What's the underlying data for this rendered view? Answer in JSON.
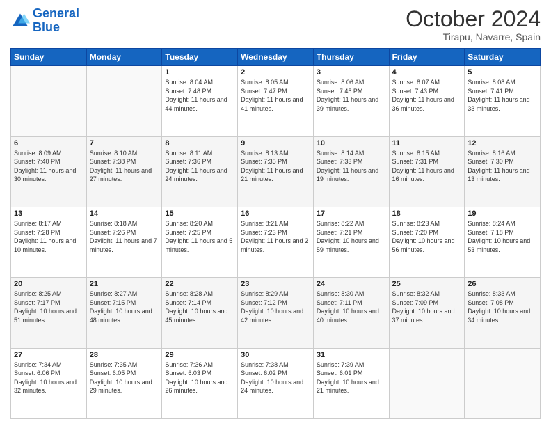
{
  "logo": {
    "text_general": "General",
    "text_blue": "Blue"
  },
  "title": "October 2024",
  "location": "Tirapu, Navarre, Spain",
  "days_of_week": [
    "Sunday",
    "Monday",
    "Tuesday",
    "Wednesday",
    "Thursday",
    "Friday",
    "Saturday"
  ],
  "weeks": [
    [
      {
        "day": "",
        "sunrise": "",
        "sunset": "",
        "daylight": ""
      },
      {
        "day": "",
        "sunrise": "",
        "sunset": "",
        "daylight": ""
      },
      {
        "day": "1",
        "sunrise": "Sunrise: 8:04 AM",
        "sunset": "Sunset: 7:48 PM",
        "daylight": "Daylight: 11 hours and 44 minutes."
      },
      {
        "day": "2",
        "sunrise": "Sunrise: 8:05 AM",
        "sunset": "Sunset: 7:47 PM",
        "daylight": "Daylight: 11 hours and 41 minutes."
      },
      {
        "day": "3",
        "sunrise": "Sunrise: 8:06 AM",
        "sunset": "Sunset: 7:45 PM",
        "daylight": "Daylight: 11 hours and 39 minutes."
      },
      {
        "day": "4",
        "sunrise": "Sunrise: 8:07 AM",
        "sunset": "Sunset: 7:43 PM",
        "daylight": "Daylight: 11 hours and 36 minutes."
      },
      {
        "day": "5",
        "sunrise": "Sunrise: 8:08 AM",
        "sunset": "Sunset: 7:41 PM",
        "daylight": "Daylight: 11 hours and 33 minutes."
      }
    ],
    [
      {
        "day": "6",
        "sunrise": "Sunrise: 8:09 AM",
        "sunset": "Sunset: 7:40 PM",
        "daylight": "Daylight: 11 hours and 30 minutes."
      },
      {
        "day": "7",
        "sunrise": "Sunrise: 8:10 AM",
        "sunset": "Sunset: 7:38 PM",
        "daylight": "Daylight: 11 hours and 27 minutes."
      },
      {
        "day": "8",
        "sunrise": "Sunrise: 8:11 AM",
        "sunset": "Sunset: 7:36 PM",
        "daylight": "Daylight: 11 hours and 24 minutes."
      },
      {
        "day": "9",
        "sunrise": "Sunrise: 8:13 AM",
        "sunset": "Sunset: 7:35 PM",
        "daylight": "Daylight: 11 hours and 21 minutes."
      },
      {
        "day": "10",
        "sunrise": "Sunrise: 8:14 AM",
        "sunset": "Sunset: 7:33 PM",
        "daylight": "Daylight: 11 hours and 19 minutes."
      },
      {
        "day": "11",
        "sunrise": "Sunrise: 8:15 AM",
        "sunset": "Sunset: 7:31 PM",
        "daylight": "Daylight: 11 hours and 16 minutes."
      },
      {
        "day": "12",
        "sunrise": "Sunrise: 8:16 AM",
        "sunset": "Sunset: 7:30 PM",
        "daylight": "Daylight: 11 hours and 13 minutes."
      }
    ],
    [
      {
        "day": "13",
        "sunrise": "Sunrise: 8:17 AM",
        "sunset": "Sunset: 7:28 PM",
        "daylight": "Daylight: 11 hours and 10 minutes."
      },
      {
        "day": "14",
        "sunrise": "Sunrise: 8:18 AM",
        "sunset": "Sunset: 7:26 PM",
        "daylight": "Daylight: 11 hours and 7 minutes."
      },
      {
        "day": "15",
        "sunrise": "Sunrise: 8:20 AM",
        "sunset": "Sunset: 7:25 PM",
        "daylight": "Daylight: 11 hours and 5 minutes."
      },
      {
        "day": "16",
        "sunrise": "Sunrise: 8:21 AM",
        "sunset": "Sunset: 7:23 PM",
        "daylight": "Daylight: 11 hours and 2 minutes."
      },
      {
        "day": "17",
        "sunrise": "Sunrise: 8:22 AM",
        "sunset": "Sunset: 7:21 PM",
        "daylight": "Daylight: 10 hours and 59 minutes."
      },
      {
        "day": "18",
        "sunrise": "Sunrise: 8:23 AM",
        "sunset": "Sunset: 7:20 PM",
        "daylight": "Daylight: 10 hours and 56 minutes."
      },
      {
        "day": "19",
        "sunrise": "Sunrise: 8:24 AM",
        "sunset": "Sunset: 7:18 PM",
        "daylight": "Daylight: 10 hours and 53 minutes."
      }
    ],
    [
      {
        "day": "20",
        "sunrise": "Sunrise: 8:25 AM",
        "sunset": "Sunset: 7:17 PM",
        "daylight": "Daylight: 10 hours and 51 minutes."
      },
      {
        "day": "21",
        "sunrise": "Sunrise: 8:27 AM",
        "sunset": "Sunset: 7:15 PM",
        "daylight": "Daylight: 10 hours and 48 minutes."
      },
      {
        "day": "22",
        "sunrise": "Sunrise: 8:28 AM",
        "sunset": "Sunset: 7:14 PM",
        "daylight": "Daylight: 10 hours and 45 minutes."
      },
      {
        "day": "23",
        "sunrise": "Sunrise: 8:29 AM",
        "sunset": "Sunset: 7:12 PM",
        "daylight": "Daylight: 10 hours and 42 minutes."
      },
      {
        "day": "24",
        "sunrise": "Sunrise: 8:30 AM",
        "sunset": "Sunset: 7:11 PM",
        "daylight": "Daylight: 10 hours and 40 minutes."
      },
      {
        "day": "25",
        "sunrise": "Sunrise: 8:32 AM",
        "sunset": "Sunset: 7:09 PM",
        "daylight": "Daylight: 10 hours and 37 minutes."
      },
      {
        "day": "26",
        "sunrise": "Sunrise: 8:33 AM",
        "sunset": "Sunset: 7:08 PM",
        "daylight": "Daylight: 10 hours and 34 minutes."
      }
    ],
    [
      {
        "day": "27",
        "sunrise": "Sunrise: 7:34 AM",
        "sunset": "Sunset: 6:06 PM",
        "daylight": "Daylight: 10 hours and 32 minutes."
      },
      {
        "day": "28",
        "sunrise": "Sunrise: 7:35 AM",
        "sunset": "Sunset: 6:05 PM",
        "daylight": "Daylight: 10 hours and 29 minutes."
      },
      {
        "day": "29",
        "sunrise": "Sunrise: 7:36 AM",
        "sunset": "Sunset: 6:03 PM",
        "daylight": "Daylight: 10 hours and 26 minutes."
      },
      {
        "day": "30",
        "sunrise": "Sunrise: 7:38 AM",
        "sunset": "Sunset: 6:02 PM",
        "daylight": "Daylight: 10 hours and 24 minutes."
      },
      {
        "day": "31",
        "sunrise": "Sunrise: 7:39 AM",
        "sunset": "Sunset: 6:01 PM",
        "daylight": "Daylight: 10 hours and 21 minutes."
      },
      {
        "day": "",
        "sunrise": "",
        "sunset": "",
        "daylight": ""
      },
      {
        "day": "",
        "sunrise": "",
        "sunset": "",
        "daylight": ""
      }
    ]
  ]
}
